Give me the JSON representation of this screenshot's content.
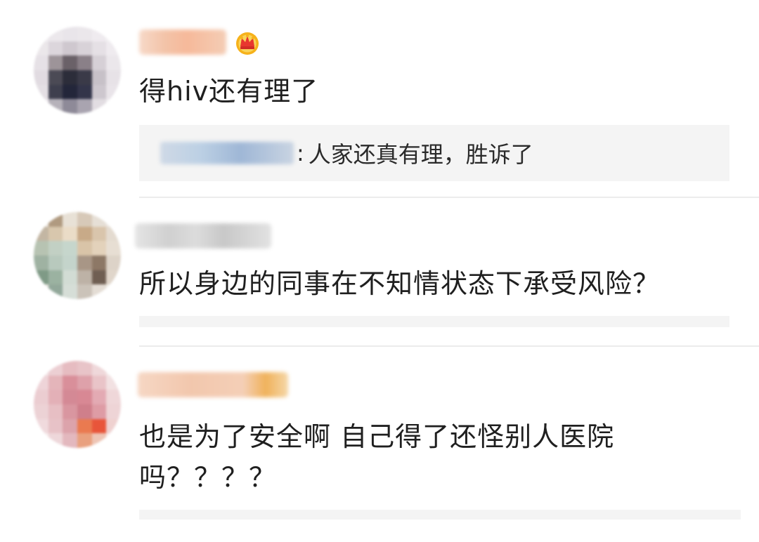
{
  "comments": [
    {
      "text": "得hiv还有理了",
      "badge_icon": "crown-icon",
      "reply": {
        "separator": ":",
        "text": "人家还真有理，胜诉了"
      }
    },
    {
      "text": "所以身边的同事在不知情状态下承受风险？"
    },
    {
      "text_line1": "也是为了安全啊 自己得了还怪别人医院",
      "text_line2": "吗？？？？"
    }
  ]
}
